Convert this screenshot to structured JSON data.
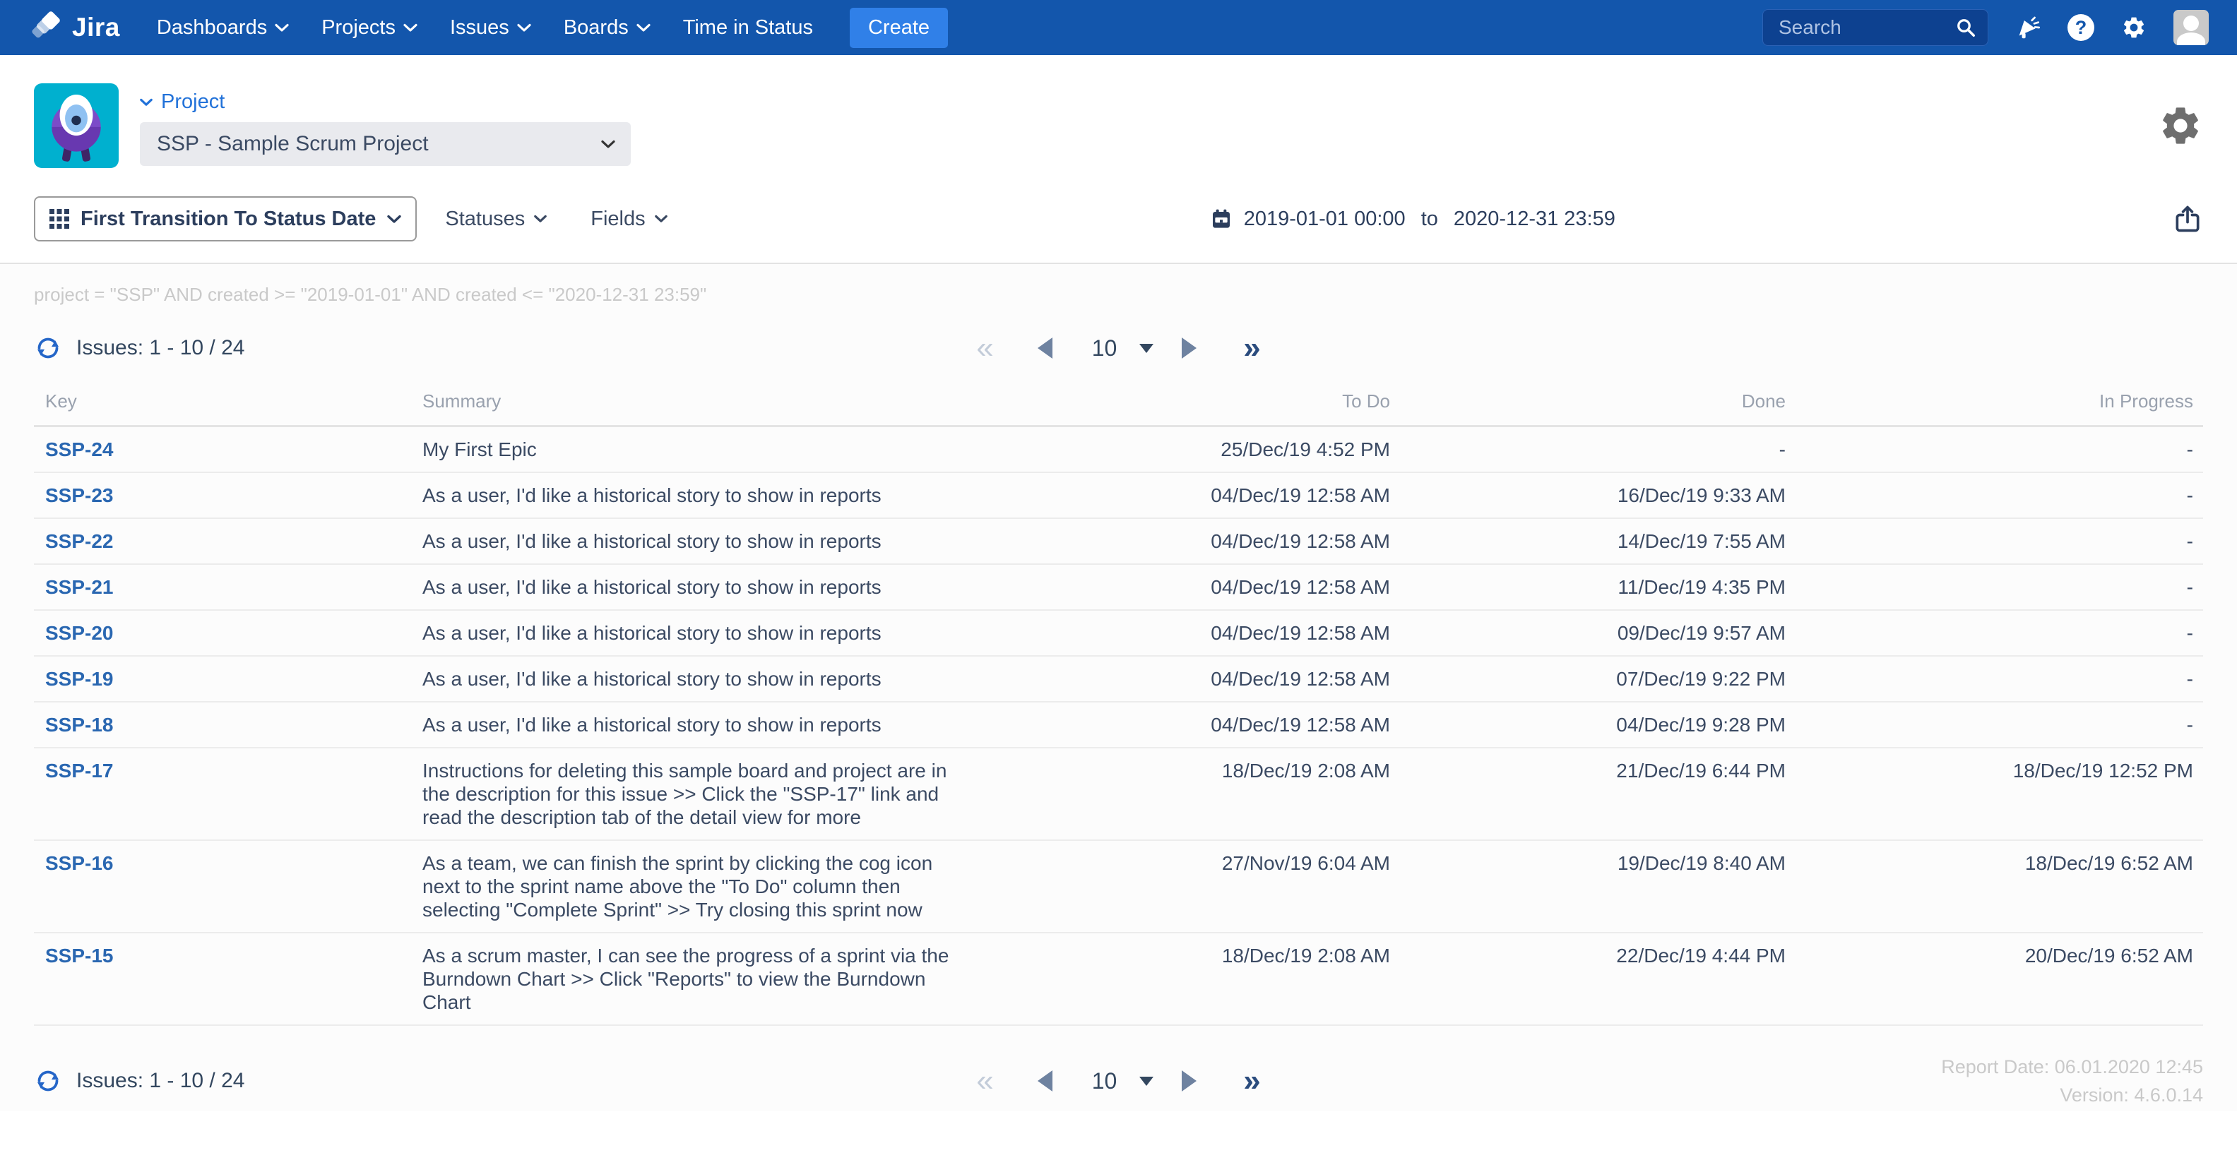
{
  "colors": {
    "nav_blue": "#1356AC",
    "create_button_blue": "#3080E8",
    "project_label_blue": "#2272D9",
    "issue_link_blue": "#2A67B1",
    "refresh_blue": "#2566C8",
    "text_dark": "#3B4A63",
    "muted_gray": "#99A1AE",
    "faint_gray": "#C9C9C9",
    "avatar_teal": "#00B0CF"
  },
  "nav": {
    "brand": "Jira",
    "items": [
      {
        "label": "Dashboards",
        "caret": true
      },
      {
        "label": "Projects",
        "caret": true
      },
      {
        "label": "Issues",
        "caret": true
      },
      {
        "label": "Boards",
        "caret": true
      },
      {
        "label": "Time in Status",
        "caret": false
      }
    ],
    "create_label": "Create",
    "search_placeholder": "Search"
  },
  "project_header": {
    "section_label": "Project",
    "selected_project": "SSP - Sample Scrum Project"
  },
  "toolbar": {
    "report_type": "First Transition To Status Date",
    "statuses_label": "Statuses",
    "fields_label": "Fields",
    "date_from": "2019-01-01 00:00",
    "date_separator": "to",
    "date_to": "2020-12-31 23:59"
  },
  "jql": "project = \"SSP\" AND created >= \"2019-01-01\" AND created <= \"2020-12-31 23:59\"",
  "list": {
    "issues_counter": "Issues: 1 - 10 / 24",
    "page_size": "10",
    "first_glyph": "«",
    "last_glyph": "»"
  },
  "table": {
    "columns": [
      "Key",
      "Summary",
      "To Do",
      "Done",
      "In Progress"
    ],
    "rows": [
      {
        "key": "SSP-24",
        "summary": "My First Epic",
        "to_do": "25/Dec/19 4:52 PM",
        "done": "-",
        "in_progress": "-"
      },
      {
        "key": "SSP-23",
        "summary": "As a user, I'd like a historical story to show in reports",
        "to_do": "04/Dec/19 12:58 AM",
        "done": "16/Dec/19 9:33 AM",
        "in_progress": "-"
      },
      {
        "key": "SSP-22",
        "summary": "As a user, I'd like a historical story to show in reports",
        "to_do": "04/Dec/19 12:58 AM",
        "done": "14/Dec/19 7:55 AM",
        "in_progress": "-"
      },
      {
        "key": "SSP-21",
        "summary": "As a user, I'd like a historical story to show in reports",
        "to_do": "04/Dec/19 12:58 AM",
        "done": "11/Dec/19 4:35 PM",
        "in_progress": "-"
      },
      {
        "key": "SSP-20",
        "summary": "As a user, I'd like a historical story to show in reports",
        "to_do": "04/Dec/19 12:58 AM",
        "done": "09/Dec/19 9:57 AM",
        "in_progress": "-"
      },
      {
        "key": "SSP-19",
        "summary": "As a user, I'd like a historical story to show in reports",
        "to_do": "04/Dec/19 12:58 AM",
        "done": "07/Dec/19 9:22 PM",
        "in_progress": "-"
      },
      {
        "key": "SSP-18",
        "summary": "As a user, I'd like a historical story to show in reports",
        "to_do": "04/Dec/19 12:58 AM",
        "done": "04/Dec/19 9:28 PM",
        "in_progress": "-"
      },
      {
        "key": "SSP-17",
        "summary": "Instructions for deleting this sample board and project are in the description for this issue >> Click the \"SSP-17\" link and read the description tab of the detail view for more",
        "to_do": "18/Dec/19 2:08 AM",
        "done": "21/Dec/19 6:44 PM",
        "in_progress": "18/Dec/19 12:52 PM"
      },
      {
        "key": "SSP-16",
        "summary": "As a team, we can finish the sprint by clicking the cog icon next to the sprint name above the \"To Do\" column then selecting \"Complete Sprint\" >> Try closing this sprint now",
        "to_do": "27/Nov/19 6:04 AM",
        "done": "19/Dec/19 8:40 AM",
        "in_progress": "18/Dec/19 6:52 AM"
      },
      {
        "key": "SSP-15",
        "summary": "As a scrum master, I can see the progress of a sprint via the Burndown Chart >> Click \"Reports\" to view the Burndown Chart",
        "to_do": "18/Dec/19 2:08 AM",
        "done": "22/Dec/19 4:44 PM",
        "in_progress": "20/Dec/19 6:52 AM"
      }
    ]
  },
  "footer": {
    "report_date": "Report Date: 06.01.2020 12:45",
    "version": "Version: 4.6.0.14"
  }
}
